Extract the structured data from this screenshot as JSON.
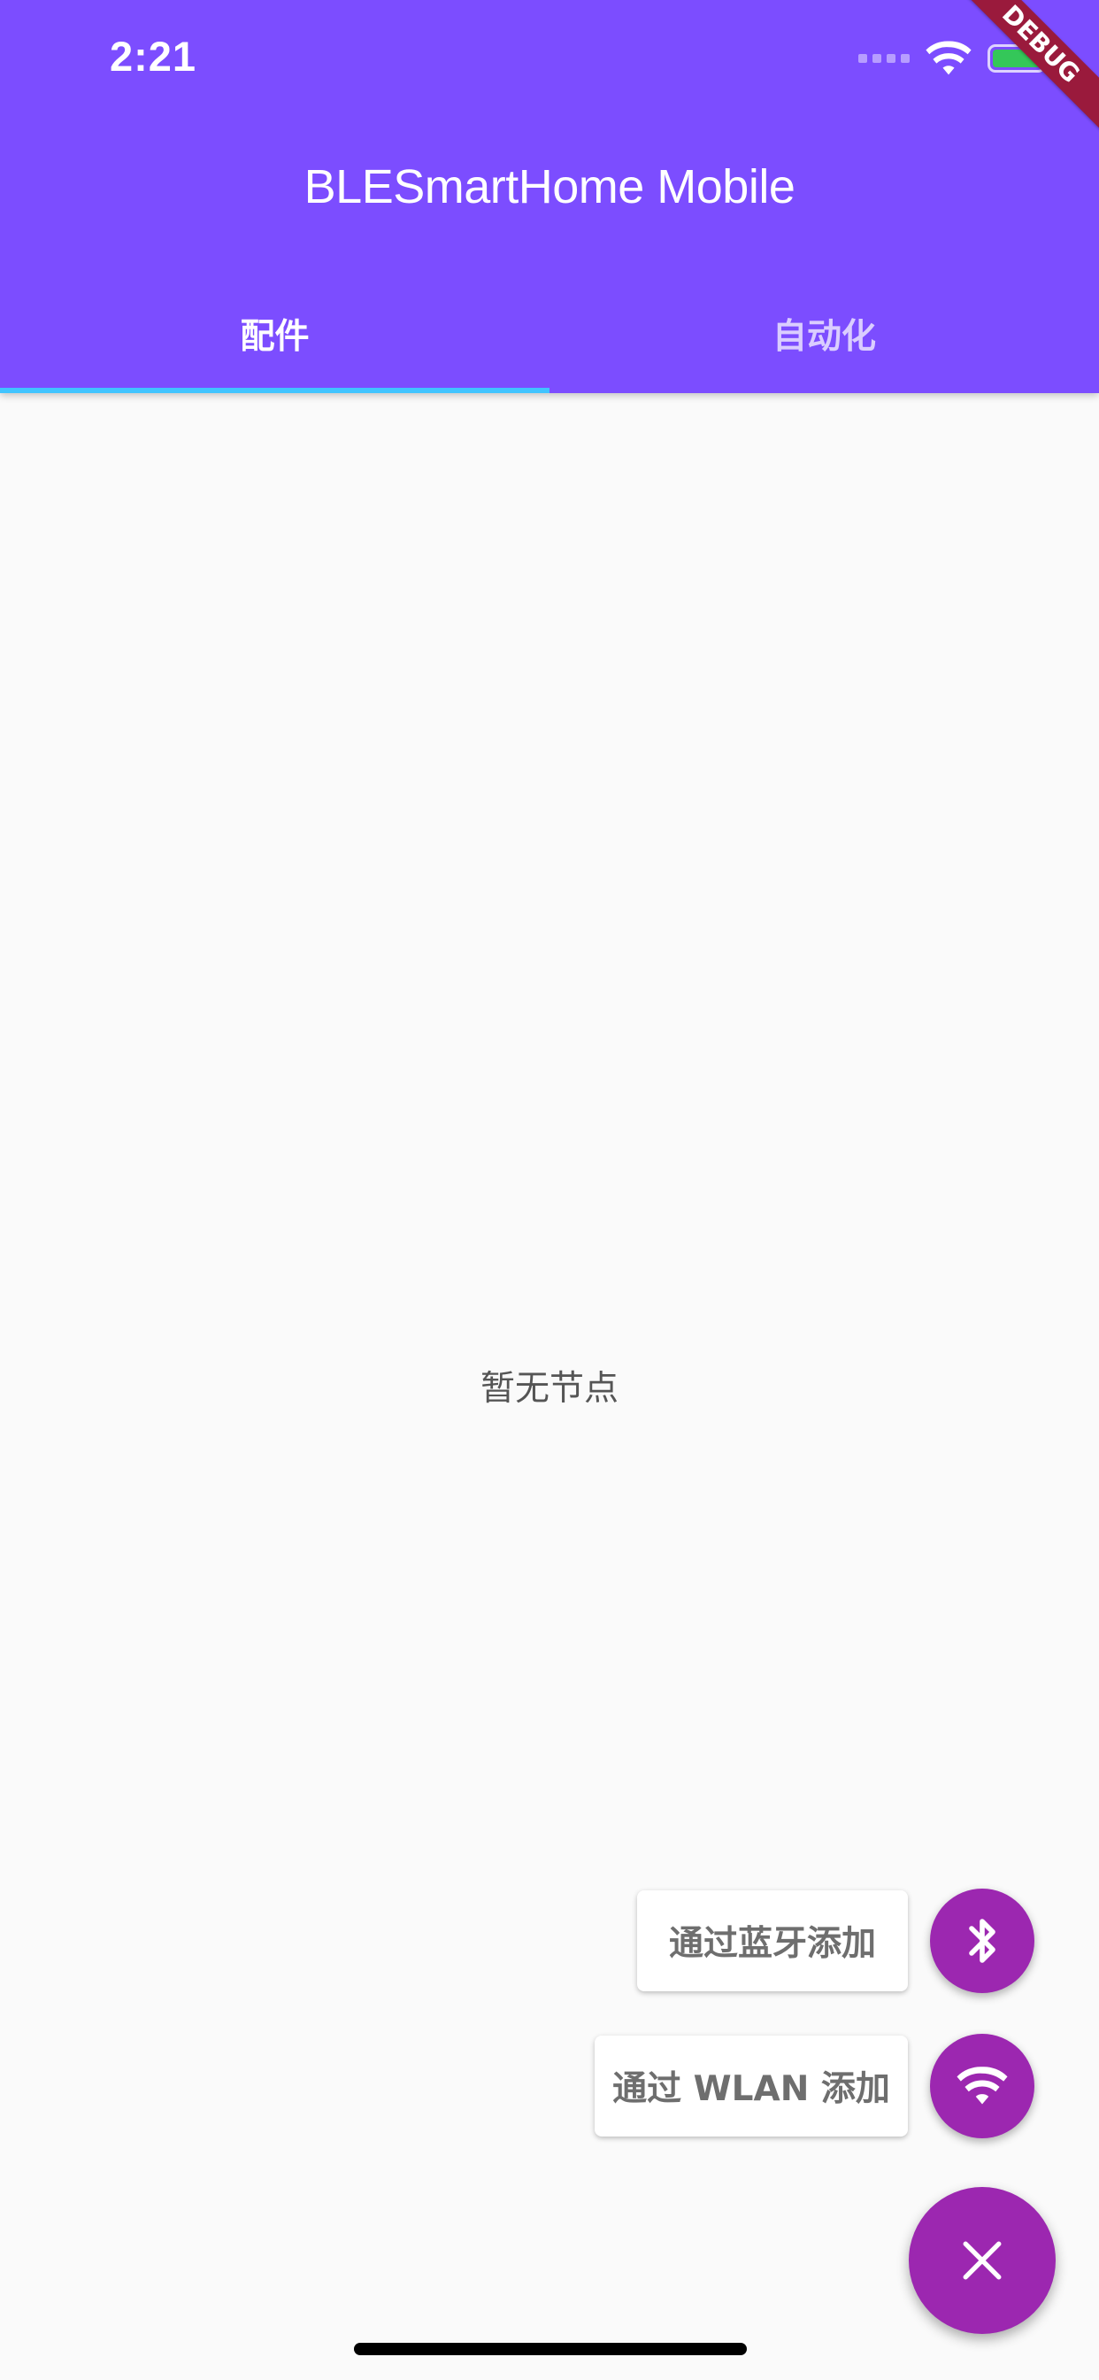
{
  "status_bar": {
    "time": "2:21"
  },
  "debug_banner": {
    "text": "DEBUG"
  },
  "app_bar": {
    "title": "BLESmartHome Mobile",
    "background_color": "#7c4dff",
    "tabs": [
      {
        "label": "配件",
        "selected": true
      },
      {
        "label": "自动化",
        "selected": false
      }
    ],
    "indicator_color": "#40c4ff"
  },
  "main": {
    "empty_message": "暂无节点"
  },
  "speed_dial": {
    "fab_color": "#9c27b0",
    "actions": [
      {
        "label": "通过蓝牙添加",
        "icon": "bluetooth-icon"
      },
      {
        "label": "通过 WLAN 添加",
        "icon": "wifi-icon"
      }
    ],
    "main_icon": "close-icon"
  }
}
